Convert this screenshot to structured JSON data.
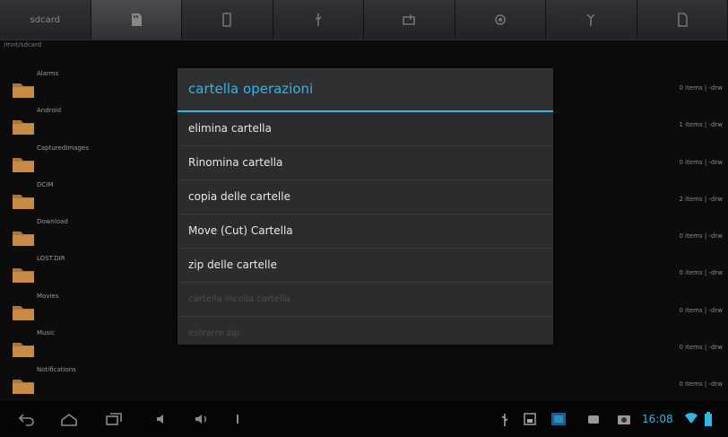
{
  "toolbar": {
    "buttons": [
      {
        "name": "home-icon",
        "label": "sdcard"
      },
      {
        "name": "sdcard-icon"
      },
      {
        "name": "phone-icon"
      },
      {
        "name": "usb-icon"
      },
      {
        "name": "gallery-icon"
      },
      {
        "name": "settings-icon"
      },
      {
        "name": "antenna-icon"
      },
      {
        "name": "document-icon"
      }
    ]
  },
  "path": "/mnt/sdcard",
  "files": [
    {
      "name": "Alarms",
      "info": "0 items | -drw"
    },
    {
      "name": "Android",
      "info": "1 items | -drw"
    },
    {
      "name": "CapturedImages",
      "info": "0 items | -drw"
    },
    {
      "name": "DCIM",
      "info": "2 items | -drw"
    },
    {
      "name": "Download",
      "info": "0 items | -drw"
    },
    {
      "name": "LOST.DIR",
      "info": "0 items | -drw"
    },
    {
      "name": "Movies",
      "info": "0 items | -drw"
    },
    {
      "name": "Music",
      "info": "0 items | -drw"
    },
    {
      "name": "Notifications",
      "info": "0 items | -drw"
    }
  ],
  "dialog": {
    "title": "cartella operazioni",
    "items": [
      {
        "label": "elimina cartella",
        "enabled": true
      },
      {
        "label": "Rinomina cartella",
        "enabled": true
      },
      {
        "label": "copia delle cartelle",
        "enabled": true
      },
      {
        "label": "Move (Cut) Cartella",
        "enabled": true
      },
      {
        "label": "zip delle cartelle",
        "enabled": true
      },
      {
        "label": "cartella incolla cartella",
        "enabled": false
      },
      {
        "label": "estrarre zip",
        "enabled": false
      }
    ]
  },
  "status": {
    "time": "16:08"
  },
  "colors": {
    "accent": "#33b5e5",
    "background": "#0c0c0d",
    "dialog": "#2b2c2e"
  }
}
